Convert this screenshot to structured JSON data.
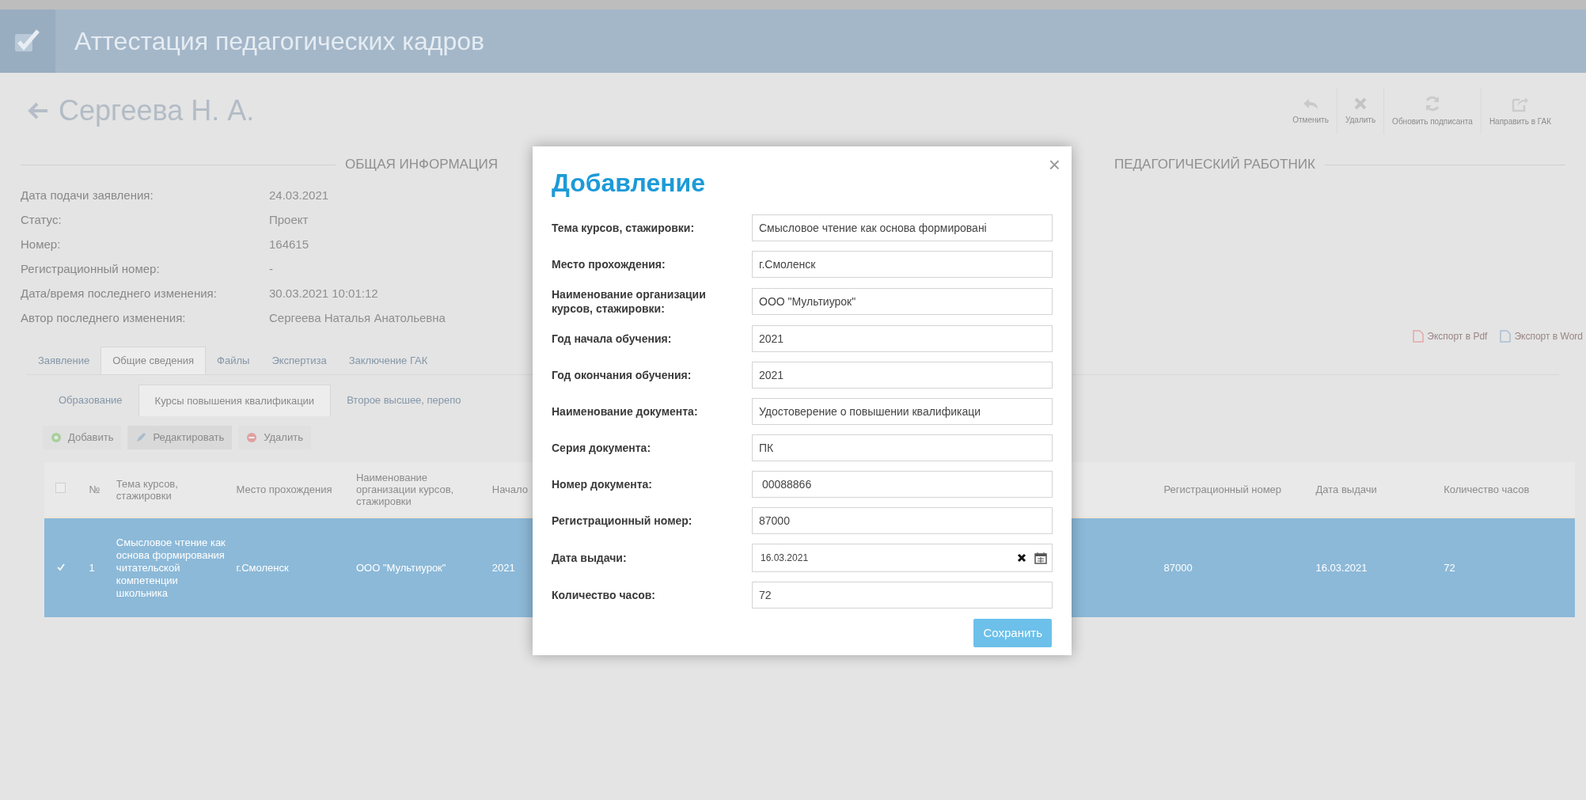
{
  "app_header": {
    "title": "Аттестация педагогических кадров"
  },
  "page": {
    "title": "Сергеева Н. А."
  },
  "toolbar": [
    {
      "label": "Отменить",
      "kind": "undo"
    },
    {
      "label": "Удалить",
      "kind": "delete"
    },
    {
      "label": "Обновить подписанта",
      "kind": "refresh"
    },
    {
      "label": "Направить в ГАК",
      "kind": "export"
    }
  ],
  "sections": [
    {
      "heading": "ОБЩАЯ ИНФОРМАЦИЯ"
    },
    {
      "heading": "ПЕДАГОГИЧЕСКИЙ РАБОТНИК"
    }
  ],
  "info": [
    {
      "label": "Дата подачи заявления:",
      "value": "24.03.2021"
    },
    {
      "label": "Статус:",
      "value": "Проект"
    },
    {
      "label": "Номер:",
      "value": "164615"
    },
    {
      "label": "Регистрационный номер:",
      "value": "-"
    },
    {
      "label": "Дата/время последнего изменения:",
      "value": "30.03.2021 10:01:12"
    },
    {
      "label": "Автор последнего изменения:",
      "value": "Сергеева Наталья Анатольевна"
    }
  ],
  "export_links": [
    {
      "label": "Экспорт в Pdf",
      "kind": "pdf"
    },
    {
      "label": "Экспорт в Word",
      "kind": "word"
    }
  ],
  "tabs": [
    {
      "label": "Заявление",
      "selected": false
    },
    {
      "label": "Общие сведения",
      "selected": true
    },
    {
      "label": "Файлы",
      "selected": false
    },
    {
      "label": "Экспертиза",
      "selected": false
    },
    {
      "label": "Заключение ГАК",
      "selected": false
    }
  ],
  "subtabs": [
    {
      "label": "Образование",
      "selected": false
    },
    {
      "label": "Курсы повышения квалификации",
      "selected": true
    },
    {
      "label": "Второе высшее, перепо",
      "selected": false
    }
  ],
  "actions": [
    {
      "label": "Добавить",
      "kind": "add"
    },
    {
      "label": "Редактировать",
      "kind": "edit"
    },
    {
      "label": "Удалить",
      "kind": "delete"
    }
  ],
  "table": {
    "columns": [
      "№",
      "Тема курсов, стажировки",
      "Место прохождения",
      "Наименование организации курсов, стажировки",
      "Начало",
      "Регистрационный номер",
      "Дата выдачи",
      "Количество часов"
    ],
    "all_checked": false,
    "rows": [
      {
        "selected": true,
        "checked": true,
        "cells": [
          "1",
          "Смысловое чтение как основа формирования читательской компетенции школьника",
          "г.Смоленск",
          "ООО \"Мультиурок\"",
          "2021",
          "87000",
          "16.03.2021",
          "72"
        ]
      }
    ]
  },
  "dialog": {
    "title": "Добавление",
    "close": "×",
    "fields": [
      {
        "label": "Тема курсов, стажировки:",
        "value": "Смысловое чтение как основа формировані",
        "kind": "text"
      },
      {
        "label": "Место прохождения:",
        "value": "г.Смоленск",
        "kind": "text"
      },
      {
        "label": "Наименование организации курсов, стажировки:",
        "value": "ООО \"Мультиурок\"",
        "kind": "text"
      },
      {
        "label": "Год начала обучения:",
        "value": "2021",
        "kind": "text"
      },
      {
        "label": "Год окончания обучения:",
        "value": "2021",
        "kind": "text"
      },
      {
        "label": "Наименование документа:",
        "value": "Удостоверение о повышении квалификаци",
        "kind": "text"
      },
      {
        "label": "Серия документа:",
        "value": "ПК",
        "kind": "text"
      },
      {
        "label": "Номер документа:",
        "value": " 00088866",
        "kind": "text"
      },
      {
        "label": "Регистрационный номер:",
        "value": "87000",
        "kind": "text"
      },
      {
        "label": "Дата выдачи:",
        "value": "16.03.2021",
        "kind": "date"
      },
      {
        "label": "Количество часов:",
        "value": "72",
        "kind": "text"
      }
    ],
    "save_button": "Сохранить"
  }
}
